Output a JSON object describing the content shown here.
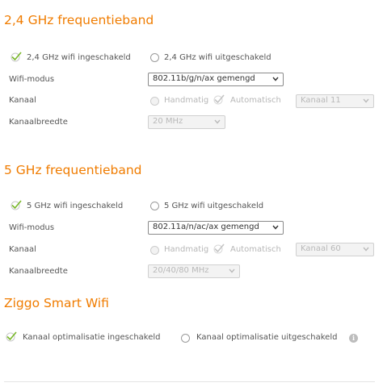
{
  "colors": {
    "accent": "#f07c00",
    "check": "#78b728"
  },
  "band24": {
    "title": "2,4 GHz frequentieband",
    "enabled_label": "2,4 GHz wifi ingeschakeld",
    "disabled_label": "2,4 GHz wifi uitgeschakeld",
    "enabled_selected": true,
    "mode_label": "Wifi-modus",
    "mode_value": "802.11b/g/n/ax gemengd",
    "channel_label": "Kanaal",
    "channel_manual": "Handmatig",
    "channel_auto": "Automatisch",
    "channel_auto_selected": true,
    "channel_value": "Kanaal 11",
    "width_label": "Kanaalbreedte",
    "width_value": "20 MHz"
  },
  "band5": {
    "title": "5 GHz frequentieband",
    "enabled_label": "5 GHz wifi ingeschakeld",
    "disabled_label": "5 GHz wifi uitgeschakeld",
    "enabled_selected": true,
    "mode_label": "Wifi-modus",
    "mode_value": "802.11a/n/ac/ax gemengd",
    "channel_label": "Kanaal",
    "channel_manual": "Handmatig",
    "channel_auto": "Automatisch",
    "channel_auto_selected": true,
    "channel_value": "Kanaal 60",
    "width_label": "Kanaalbreedte",
    "width_value": "20/40/80 MHz"
  },
  "smart": {
    "title": "Ziggo Smart Wifi",
    "enabled_label": "Kanaal optimalisatie ingeschakeld",
    "disabled_label": "Kanaal optimalisatie uitgeschakeld",
    "enabled_selected": true,
    "info_icon": "info-icon",
    "info_glyph": "i"
  }
}
